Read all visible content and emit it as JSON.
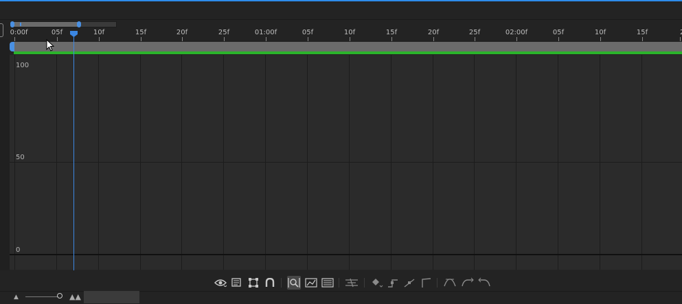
{
  "ruler": {
    "labels": [
      "0:00f",
      "05f",
      "10f",
      "15f",
      "20f",
      "25f",
      "01:00f",
      "05f",
      "10f",
      "15f",
      "20f",
      "25f",
      "02:00f",
      "05f",
      "10f",
      "15f",
      "2"
    ]
  },
  "graph": {
    "y_labels": [
      "100",
      "50",
      "0"
    ]
  },
  "playhead": {
    "frame": "07f"
  },
  "toolbar": {
    "icons": [
      "eye-icon",
      "graph-type-icon",
      "transform-box-icon",
      "snap-magnet-icon",
      "fit-selection-icon",
      "fit-all-icon",
      "zoom-all-icon",
      "separate-dimensions-icon",
      "keyframe-diamond-icon",
      "convert-hold-icon",
      "convert-linear-icon",
      "convert-auto-bezier-icon",
      "easy-ease-icon",
      "easy-ease-in-icon",
      "easy-ease-out-icon"
    ],
    "active": "fit-selection-icon"
  },
  "colors": {
    "accent": "#3b87e3",
    "work_area_green": "#2bb32b",
    "background": "#232323",
    "graph_bg": "#2b2b2b"
  }
}
